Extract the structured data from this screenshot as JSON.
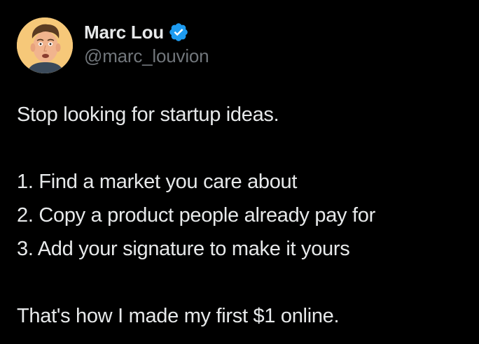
{
  "author": {
    "display_name": "Marc Lou",
    "handle": "@marc_louvion",
    "verified": true,
    "avatar_icon": "avatar-face-icon",
    "verified_icon": "verified-badge-icon",
    "verified_color": "#1d9bf0"
  },
  "tweet": {
    "line_1": "Stop looking for startup ideas.",
    "line_2": "1. Find a market you care about",
    "line_3": "2. Copy a product people already pay for",
    "line_4": "3. Add your signature to make it yours",
    "line_5": "That's how I made my first $1 online."
  },
  "colors": {
    "background": "#000000",
    "text": "#e7e9ea",
    "muted": "#71767b",
    "avatar_bg": "#f6c879"
  }
}
